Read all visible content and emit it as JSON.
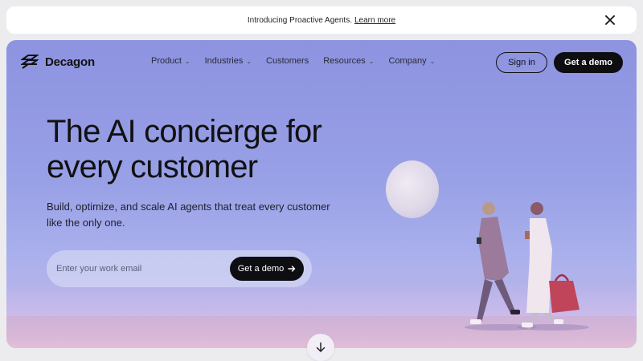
{
  "announcement": {
    "text": "Introducing Proactive Agents.",
    "link": "Learn more",
    "close_icon": "close-icon"
  },
  "nav": {
    "brand": "Decagon",
    "items": [
      {
        "label": "Product",
        "dropdown": true
      },
      {
        "label": "Industries",
        "dropdown": true
      },
      {
        "label": "Customers",
        "dropdown": false
      },
      {
        "label": "Resources",
        "dropdown": true
      },
      {
        "label": "Company",
        "dropdown": true
      }
    ],
    "signin": "Sign in",
    "demo": "Get a demo"
  },
  "hero": {
    "headline": "The AI concierge for every customer",
    "subtext": "Build, optimize, and scale AI agents that treat every customer like the only one.",
    "email_placeholder": "Enter your work email",
    "cta": "Get a demo",
    "cta_icon": "arrow-right-icon",
    "scroll_icon": "arrow-down-icon"
  },
  "colors": {
    "hero_sky": "#8d93e0",
    "button_dark": "#0e0e12",
    "ground": "#d8b6d6"
  }
}
